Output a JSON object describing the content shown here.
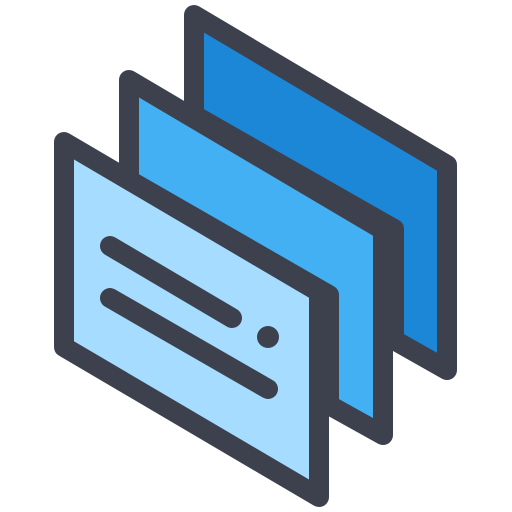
{
  "icon": {
    "name": "stacked-layers-icon",
    "colors": {
      "outline": "#3d404d",
      "back_layer": "#1b87d6",
      "middle_layer": "#42b0f3",
      "front_layer": "#a5dcff",
      "background": "#ffffff"
    }
  }
}
